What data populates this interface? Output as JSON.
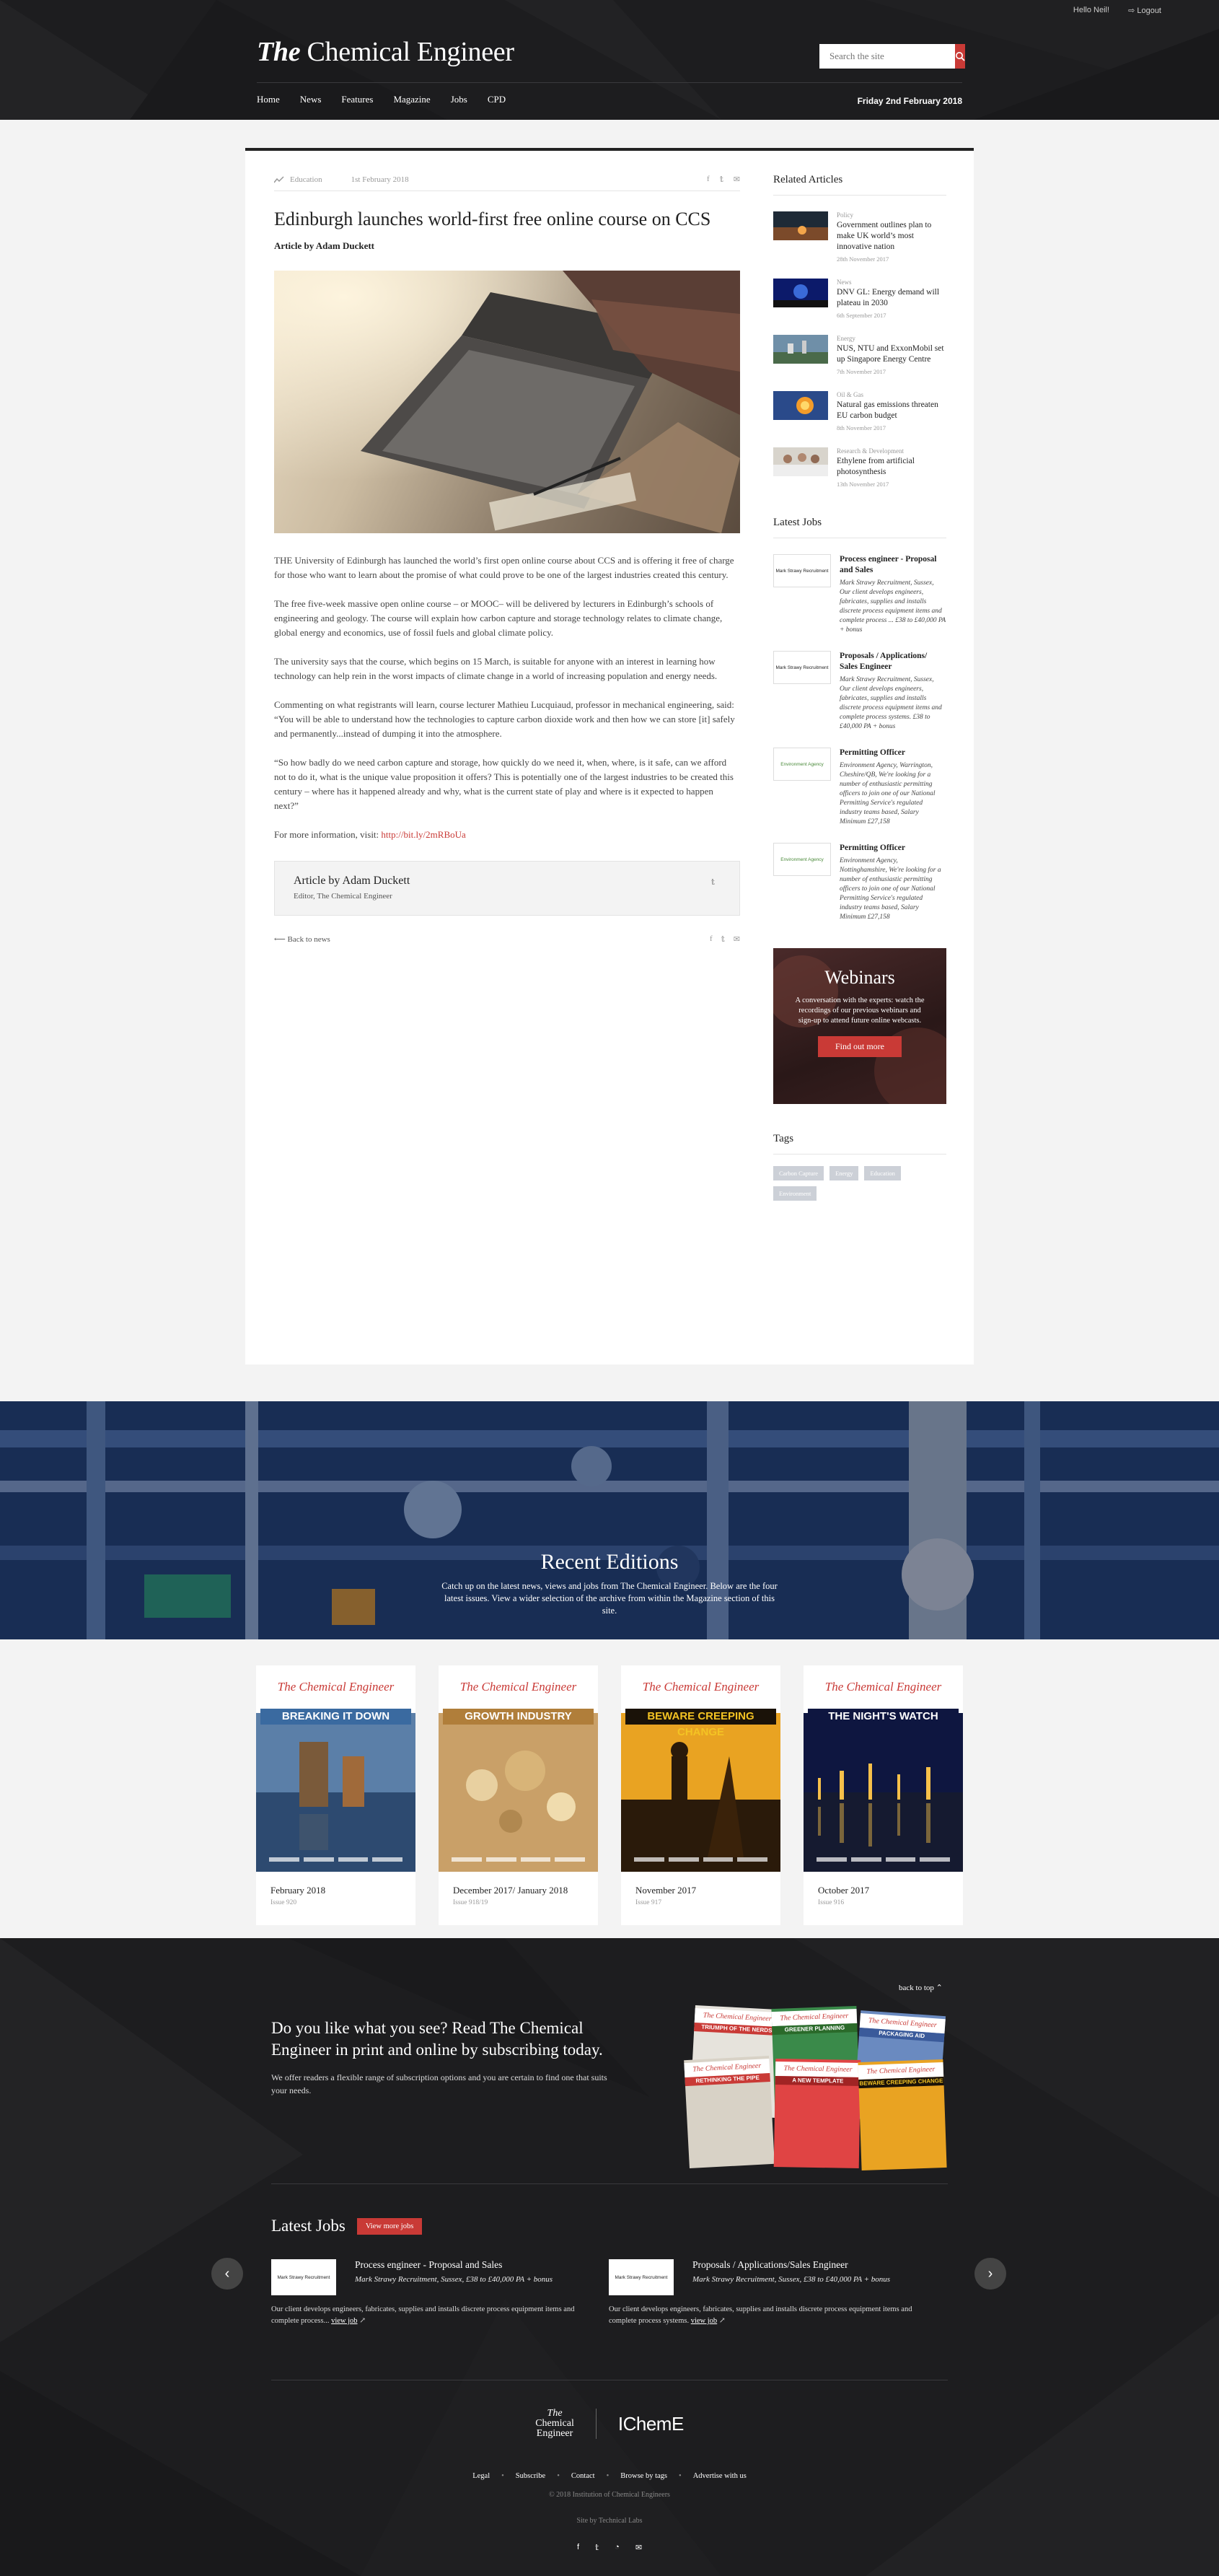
{
  "topbar": {
    "user": "Hello Neil!",
    "logout": "Logout"
  },
  "brand": {
    "logo_prefix": "The",
    "logo_main": "Chemical Engineer"
  },
  "search": {
    "placeholder": "Search the site"
  },
  "nav": [
    "Home",
    "News",
    "Features",
    "Magazine",
    "Jobs",
    "CPD"
  ],
  "date": "Friday 2nd February 2018",
  "article": {
    "category": "Education",
    "date": "1st February 2018",
    "title": "Edinburgh launches world-first free online course on CCS",
    "byline": "Article by Adam Duckett",
    "paragraphs": [
      "THE University of Edinburgh has launched the world’s first open online course about CCS and is offering it free of charge for those who want to learn about the promise of what could prove to be one of the largest industries created this century.",
      "The free five-week massive open online course – or MOOC– will be delivered by lecturers in Edinburgh’s schools of engineering and geology. The course will explain how carbon capture and storage technology relates to climate change, global energy and economics, use of fossil fuels and global climate policy.",
      "The university says that the course, which begins on 15 March, is suitable for anyone with an interest in learning how technology can help rein in the worst impacts of climate change in a world of increasing population and energy needs.",
      "Commenting on what registrants will learn, course lecturer Mathieu Lucquiaud, professor in mechanical engineering, said: “You will be able to understand how the technologies to capture carbon dioxide work and then how we can store [it] safely and permanently...instead of dumping it into the atmosphere.",
      "“So how badly do we need carbon capture and storage, how quickly do we need it, when, where, is it safe, can we afford not to do it, what is the unique value proposition it offers? This is potentially one of the largest industries to be created this century – where has it happened already and why, what is the current state of play and where is it expected to happen next?”"
    ],
    "more_info_label": "For more information, visit:",
    "more_info_link": "http://bit.ly/2mRBoUa",
    "author_box": {
      "name": "Article by Adam Duckett",
      "role": "Editor, The Chemical Engineer"
    },
    "back_label": "Back to news"
  },
  "sidebar": {
    "related_title": "Related Articles",
    "related": [
      {
        "category": "Policy",
        "title": "Government outlines plan to make UK world’s most innovative nation",
        "date": "28th November 2017"
      },
      {
        "category": "News",
        "title": "DNV GL: Energy demand will plateau in 2030",
        "date": "6th September 2017"
      },
      {
        "category": "Energy",
        "title": "NUS, NTU and ExxonMobil set up Singapore Energy Centre",
        "date": "7th November 2017"
      },
      {
        "category": "Oil & Gas",
        "title": "Natural gas emissions threaten EU carbon budget",
        "date": "8th November 2017"
      },
      {
        "category": "Research & Development",
        "title": "Ethylene from artificial photosynthesis",
        "date": "13th November 2017"
      }
    ],
    "jobs_title": "Latest Jobs",
    "jobs": [
      {
        "logo": "Mark Strawy Recruitment",
        "title": "Process engineer - Proposal and Sales",
        "desc": "Mark Strawy Recruitment, Sussex, Our client develops engineers, fabricates, supplies and installs discrete process equipment items and complete process ... £38 to £40,000 PA + bonus"
      },
      {
        "logo": "Mark Strawy Recruitment",
        "title": "Proposals / Applications/ Sales Engineer",
        "desc": "Mark Strawy Recruitment, Sussex, Our client develops engineers, fabricates, supplies and installs discrete process equipment items and complete process systems. £38 to £40,000 PA + bonus"
      },
      {
        "logo": "Environment Agency",
        "title": "Permitting Officer",
        "desc": "Environment Agency, Warrington, Cheshire/QB, We're looking for a number of enthusiastic permitting officers to join one of our National Permitting Service's regulated industry teams based, Salary Minimum £27,158"
      },
      {
        "logo": "Environment Agency",
        "title": "Permitting Officer",
        "desc": "Environment Agency, Nottinghamshire, We're looking for a number of enthusiastic permitting officers to join one of our National Permitting Service's regulated industry teams based, Salary Minimum £27,158"
      }
    ],
    "webinar": {
      "title": "Webinars",
      "text": "A conversation with the experts: watch the recordings of our previous webinars and sign-up to attend future online webcasts.",
      "cta": "Find out more"
    },
    "tags_title": "Tags",
    "tags": [
      "Carbon Capture",
      "Energy",
      "Education",
      "Environment"
    ]
  },
  "editions_banner": {
    "title": "Recent Editions",
    "text": "Catch up on the latest news, views and jobs from The Chemical Engineer. Below are the four latest issues. View a wider selection of the archive from within the Magazine section of this site."
  },
  "editions": [
    {
      "masthead": "The Chemical Engineer",
      "headline": "BREAKING IT DOWN",
      "month": "February 2018",
      "issue": "Issue 920",
      "color": "#4a77b0"
    },
    {
      "masthead": "The Chemical Engineer",
      "headline": "GROWTH INDUSTRY",
      "month": "December 2017/ January 2018",
      "issue": "Issue 918/19",
      "color": "#d9b45a"
    },
    {
      "masthead": "The Chemical Engineer",
      "headline": "BEWARE CREEPING CHANGE",
      "month": "November 2017",
      "issue": "Issue 917",
      "color": "#f4c323"
    },
    {
      "masthead": "The Chemical Engineer",
      "headline": "THE NIGHT'S WATCH",
      "month": "October 2017",
      "issue": "Issue 916",
      "color": "#ffffff"
    }
  ],
  "footer": {
    "back_to_top": "back to top",
    "subscribe_title": "Do you like what you see? Read The Chemical Engineer in print and online by subscribing today.",
    "subscribe_text": "We offer readers a flexible range of subscription options and you are certain to find one that suits your needs.",
    "mag_stack": [
      "TRIUMPH OF THE NERDS",
      "GREENER PLANNING",
      "PACKAGING AID",
      "RETHINKING THE PIPE",
      "A NEW TEMPLATE",
      "BEWARE CREEPING CHANGE"
    ],
    "latest_jobs_title": "Latest Jobs",
    "view_more": "View more jobs",
    "jobs": [
      {
        "logo": "Mark Strawy Recruitment",
        "title": "Process engineer - Proposal and Sales",
        "company": "Mark Strawy Recruitment, Sussex, £38 to £40,000 PA + bonus",
        "desc": "Our client develops engineers, fabricates, supplies and installs discrete process equipment items and complete process...",
        "link": "view job"
      },
      {
        "logo": "Mark Strawy Recruitment",
        "title": "Proposals / Applications/Sales Engineer",
        "company": "Mark Strawy Recruitment, Sussex, £38 to £40,000 PA + bonus",
        "desc": "Our client develops engineers, fabricates, supplies and installs discrete process equipment items and complete process systems.",
        "link": "view job"
      }
    ],
    "logo_tce": [
      "The",
      "Chemical",
      "Engineer"
    ],
    "logo_icheme": "IChemE",
    "links": [
      "Legal",
      "Subscribe",
      "Contact",
      "Browse by tags",
      "Advertise with us"
    ],
    "copyright": "© 2018 Institution of Chemical Engineers",
    "credit": "Site by Technical Labs"
  },
  "colors": {
    "accent": "#c93a36",
    "dark": "#1d1d1f"
  }
}
